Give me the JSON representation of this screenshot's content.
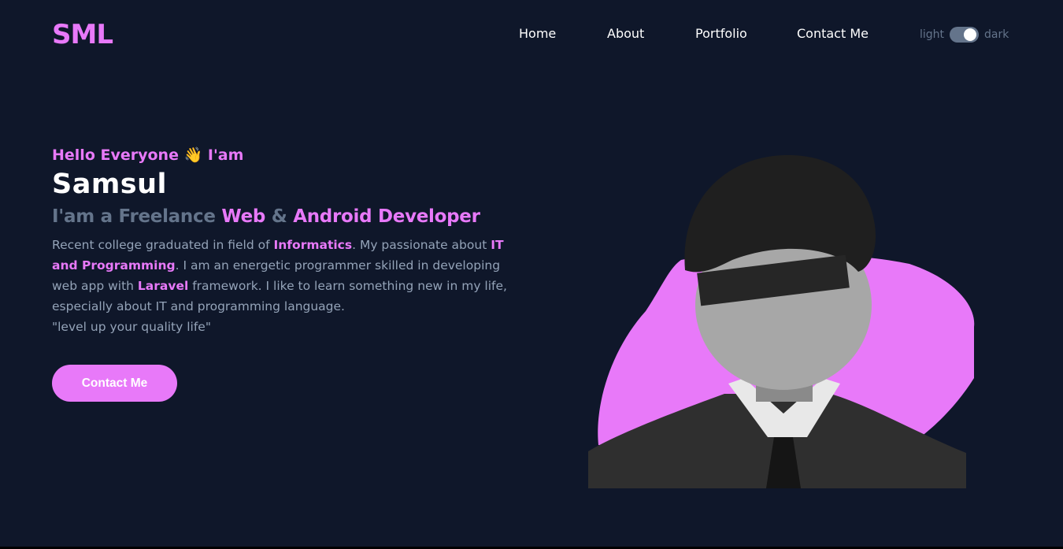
{
  "brand": {
    "logo": "SML"
  },
  "nav": {
    "items": [
      {
        "label": "Home"
      },
      {
        "label": "About"
      },
      {
        "label": "Portfolio"
      },
      {
        "label": "Contact Me"
      }
    ],
    "theme": {
      "light_label": "light",
      "dark_label": "dark",
      "mode": "dark"
    }
  },
  "hero": {
    "greeting": "Hello Everyone",
    "wave": "👋",
    "greeting_tail": "I'am",
    "name": "Samsul",
    "role": {
      "prefix": "I'am a Freelance ",
      "highlight1": "Web",
      "middle": " & ",
      "highlight2": "Android Developer"
    },
    "bio": {
      "p1": "Recent college graduated in field of ",
      "h1": "Informatics",
      "p2": ". My passionate about ",
      "h2": "IT and Programming",
      "p3": ". I am an energetic programmer skilled in developing web app with ",
      "h3": "Laravel",
      "p4": " framework. I like to learn something new in my life, especially about IT and programming language.",
      "quote": "\"level up your quality life\""
    },
    "cta_label": "Contact Me"
  },
  "colors": {
    "background": "#0f172a",
    "accent": "#e879f9",
    "muted": "#64748b",
    "body_text": "#94a3b8",
    "heading": "#ffffff"
  }
}
